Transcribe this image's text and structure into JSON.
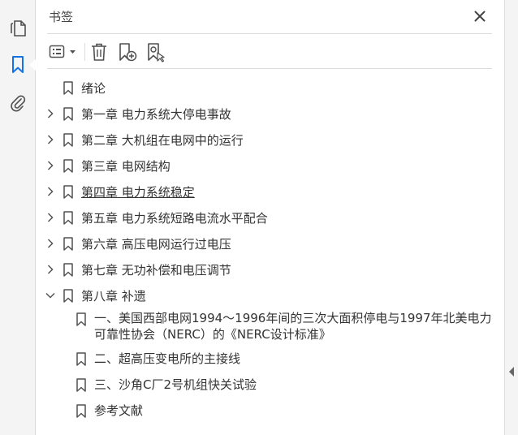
{
  "panel": {
    "title": "书签"
  },
  "colors": {
    "accent": "#1473e6",
    "icon": "#505050"
  },
  "rail_icons": [
    "pages-icon",
    "bookmark-icon",
    "attachment-icon"
  ],
  "bookmarks": [
    {
      "label": "绪论",
      "expandable": false
    },
    {
      "label": "第一章  电力系统大停电事故",
      "expandable": true,
      "expanded": false
    },
    {
      "label": "第二章  大机组在电网中的运行",
      "expandable": true,
      "expanded": false
    },
    {
      "label": "第三章  电网结构",
      "expandable": true,
      "expanded": false
    },
    {
      "label": "第四章  电力系统稳定",
      "expandable": true,
      "expanded": false,
      "hovered": true
    },
    {
      "label": "第五章  电力系统短路电流水平配合",
      "expandable": true,
      "expanded": false
    },
    {
      "label": "第六章  高压电网运行过电压",
      "expandable": true,
      "expanded": false
    },
    {
      "label": "第七章  无功补偿和电压调节",
      "expandable": true,
      "expanded": false
    },
    {
      "label": "第八章  补遗",
      "expandable": true,
      "expanded": true
    }
  ],
  "sub_bookmarks": [
    {
      "label": "一、美国西部电网1994～1996年间的三次大面积停电与1997年北美电力可靠性协会（NERC）的《NERC设计标准》"
    },
    {
      "label": "二、超高压变电所的主接线"
    },
    {
      "label": "三、沙角C厂2号机组快关试验"
    },
    {
      "label": "参考文献"
    }
  ]
}
